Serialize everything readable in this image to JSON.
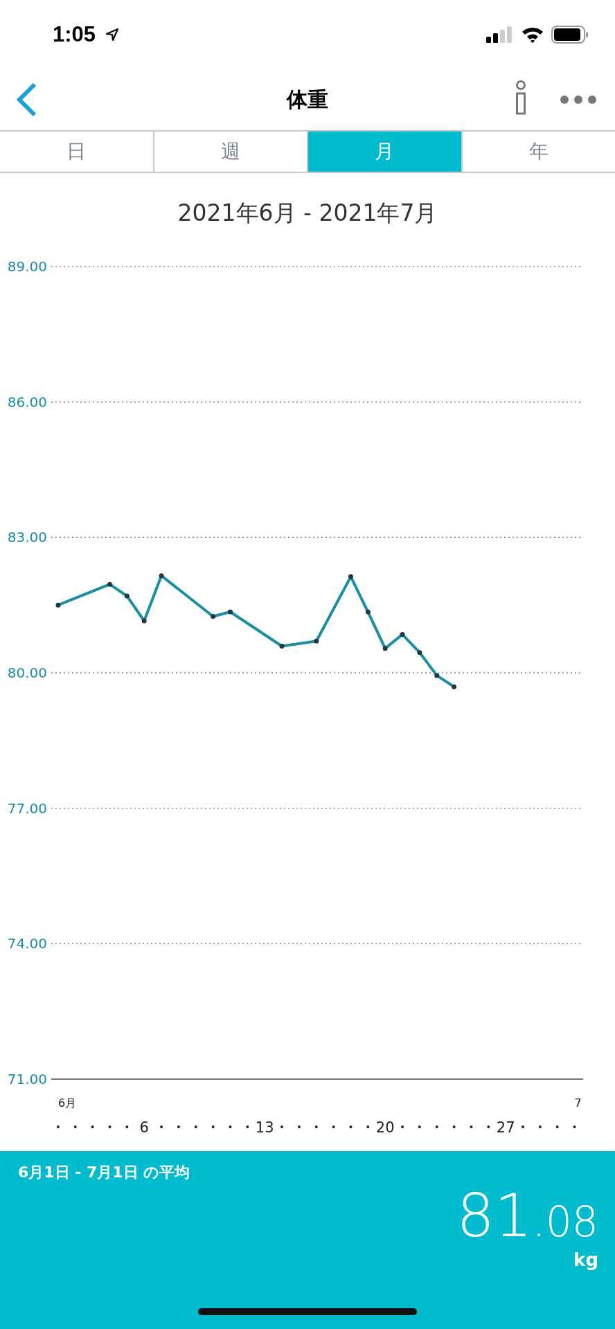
{
  "status_bar": {
    "time": "1:05"
  },
  "nav": {
    "title": "体重"
  },
  "tabs": [
    {
      "label": "日",
      "selected": false
    },
    {
      "label": "週",
      "selected": false
    },
    {
      "label": "月",
      "selected": true
    },
    {
      "label": "年",
      "selected": false
    }
  ],
  "period": "2021年6月 - 2021年7月",
  "chart": {
    "months": [
      "6月",
      "7"
    ],
    "chart_data": {
      "type": "line",
      "x": [
        1,
        4,
        5,
        6,
        7,
        10,
        11,
        14,
        16,
        18,
        19,
        20,
        21,
        22,
        23,
        24
      ],
      "grid": true,
      "series": [
        {
          "color": "#1a8ea2",
          "marker": "circle",
          "values": [
            81.5,
            81.96,
            81.7,
            81.15,
            82.15,
            81.25,
            81.35,
            80.59,
            80.7,
            82.13,
            81.35,
            80.54,
            80.85,
            80.45,
            79.94,
            79.69
          ]
        }
      ],
      "xlim": [
        0.6,
        31.5
      ],
      "ylim": [
        71,
        89
      ],
      "xticks": [
        {
          "value": 6,
          "label": "6"
        },
        {
          "value": 13,
          "label": "13"
        },
        {
          "value": 20,
          "label": "20"
        },
        {
          "value": 27,
          "label": "27"
        }
      ],
      "yticks": [
        {
          "value": 89,
          "label": "89.00"
        },
        {
          "value": 86,
          "label": "86.00"
        },
        {
          "value": 83,
          "label": "83.00"
        },
        {
          "value": 80,
          "label": "80.00"
        },
        {
          "value": 77,
          "label": "77.00"
        },
        {
          "value": 74,
          "label": "74.00"
        },
        {
          "value": 71,
          "label": "71.00"
        }
      ]
    }
  },
  "summary": {
    "label": "6月1日 - 7月1日 の平均",
    "integer": "81",
    "decimal": ".08",
    "unit": "kg"
  }
}
